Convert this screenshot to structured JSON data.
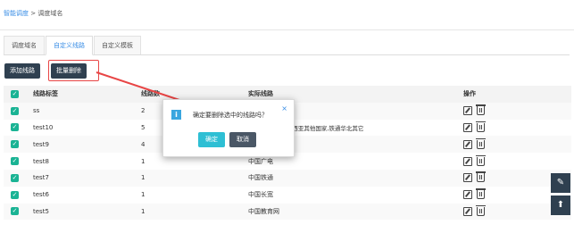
{
  "breadcrumb": {
    "parent": "智能调度",
    "separator": " > ",
    "current": "调度域名"
  },
  "tabs": [
    {
      "label": "调度域名",
      "active": false
    },
    {
      "label": "自定义线路",
      "active": true
    },
    {
      "label": "自定义模板",
      "active": false
    }
  ],
  "toolbar": {
    "add_label": "添加线路",
    "batch_delete_label": "批量删除"
  },
  "table": {
    "headers": [
      "线路标签",
      "线路数",
      "实际线路",
      "操作"
    ],
    "rows": [
      {
        "tag": "ss",
        "count": "2",
        "actual": ""
      },
      {
        "tag": "test10",
        "count": "5",
        "actual": "...用,上海有线通,西亚其他国家,铁通华北其它"
      },
      {
        "tag": "test9",
        "count": "4",
        "actual": "...州"
      },
      {
        "tag": "test8",
        "count": "1",
        "actual": "中国广电"
      },
      {
        "tag": "test7",
        "count": "1",
        "actual": "中国铁通"
      },
      {
        "tag": "test6",
        "count": "1",
        "actual": "中国长宽"
      },
      {
        "tag": "test5",
        "count": "1",
        "actual": "中国教育网"
      }
    ]
  },
  "dialog": {
    "message": "确定要删除选中的线路吗？",
    "ok_label": "确定",
    "cancel_label": "取消",
    "close_glyph": "×",
    "icon_glyph": "i"
  },
  "float_buttons": {
    "edit_glyph": "✎",
    "top_glyph": "⬆"
  },
  "colors": {
    "accent": "#1ab394",
    "dark": "#2f4050",
    "link": "#3a8ee6",
    "highlight": "#e84545"
  }
}
